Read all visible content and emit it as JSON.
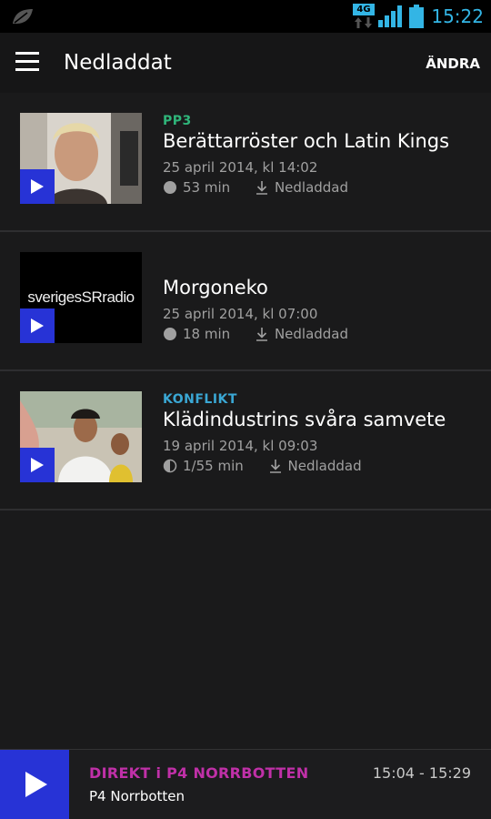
{
  "status_bar": {
    "time": "15:22",
    "network": "4G",
    "icons": [
      "leaf-icon",
      "network-arrows-icon",
      "signal-icon",
      "battery-icon"
    ]
  },
  "app_bar": {
    "title": "Nedladdat",
    "edit_label": "ÄNDRA",
    "menu_icon": "hamburger-menu-icon"
  },
  "episodes": [
    {
      "category": "PP3",
      "category_color": "#2fb57a",
      "title": "Berättarröster och Latin Kings",
      "date": "25 april 2014, kl 14:02",
      "duration": "53 min",
      "progress_icon": "progress-full-icon",
      "status": "Nedladdad"
    },
    {
      "category": "",
      "title": "Morgoneko",
      "date": "25 april 2014, kl 07:00",
      "duration": "18 min",
      "progress_icon": "progress-full-icon",
      "status": "Nedladdad",
      "thumbnail_text": "sveriges radio"
    },
    {
      "category": "KONFLIKT",
      "category_color": "#3aa7d4",
      "title": "Klädindustrins svåra samvete",
      "date": "19 april 2014, kl 09:03",
      "duration": "1/55 min",
      "progress_icon": "progress-half-icon",
      "progress_fraction": 0.018,
      "status": "Nedladdad"
    }
  ],
  "player": {
    "live_label": "DIREKT i P4 NORRBOTTEN",
    "station": "P4 Norrbotten",
    "time_range": "15:04 - 15:29",
    "accent": "#c030a8",
    "play_color": "#2733d6"
  }
}
